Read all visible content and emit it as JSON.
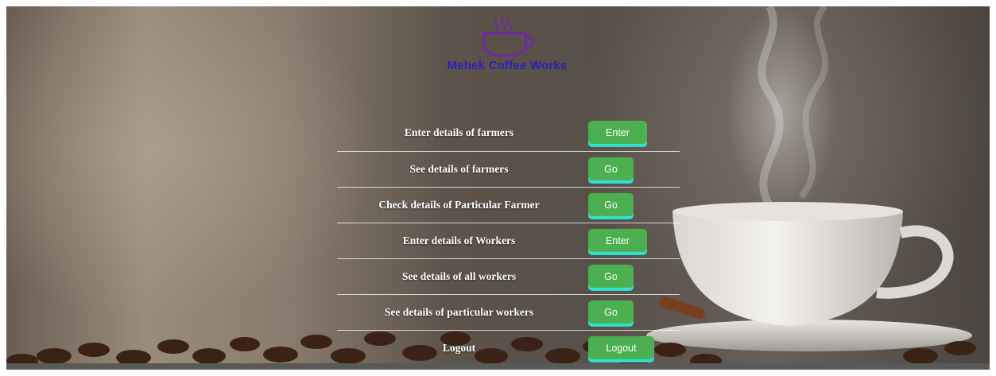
{
  "brand": {
    "name": "Mehek Coffee Works",
    "logo_icon": "coffee-cup-icon"
  },
  "colors": {
    "button": "#4caf50",
    "button_shadow": "#2fe3d0",
    "brand_text": "#2e1fb8"
  },
  "menu": [
    {
      "label": "Enter details of farmers",
      "button": "Enter",
      "kind": "enter"
    },
    {
      "label": "See details of farmers",
      "button": "Go",
      "kind": "go"
    },
    {
      "label": "Check details of Particular Farmer",
      "button": "Go",
      "kind": "go"
    },
    {
      "label": "Enter details of Workers",
      "button": "Enter",
      "kind": "enter"
    },
    {
      "label": "See details of all workers",
      "button": "Go",
      "kind": "go"
    },
    {
      "label": "See details of particular workers",
      "button": "Go",
      "kind": "go"
    },
    {
      "label": "Logout",
      "button": "Logout",
      "kind": "logout"
    }
  ]
}
